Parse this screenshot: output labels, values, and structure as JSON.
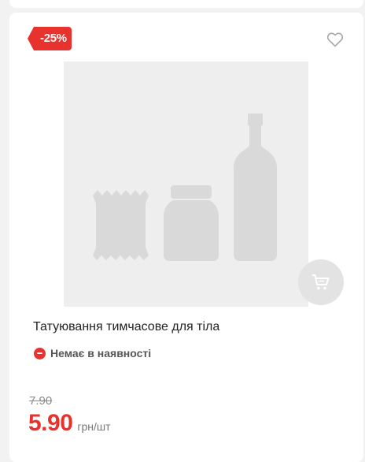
{
  "product": {
    "discount_badge": "-25%",
    "title": "Татуювання тимчасове для тіла",
    "stock_status": "Немає в наявності",
    "old_price": "7.90",
    "price": "5.90",
    "unit": "грн/шт"
  },
  "icons": {
    "wishlist": "heart-outline-icon",
    "cart": "shopping-cart-icon",
    "stock": "minus-circle-icon",
    "placeholder": "product-placeholder-image"
  },
  "colors": {
    "accent": "#e8322d",
    "placeholder_bg": "#eeeeee",
    "placeholder_shapes": "#d9d9d9",
    "cart_button_bg": "#e3e3e3"
  }
}
